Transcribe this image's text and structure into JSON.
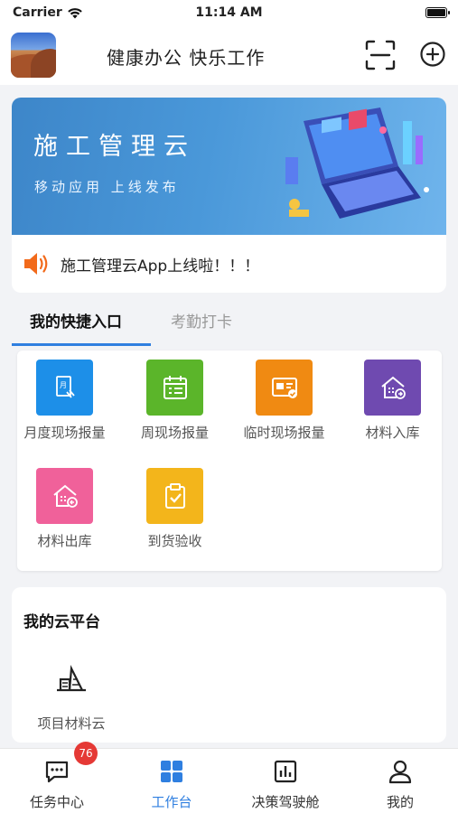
{
  "status_bar": {
    "carrier": "Carrier",
    "time": "11:14 AM"
  },
  "header": {
    "title": "健康办公 快乐工作"
  },
  "banner": {
    "title": "施工管理云",
    "subtitle": "移动应用  上线发布",
    "notice": "施工管理云App上线啦！！！"
  },
  "tabs": [
    {
      "label": "我的快捷入口",
      "active": true
    },
    {
      "label": "考勤打卡",
      "active": false
    }
  ],
  "quick_entries": [
    {
      "label": "月度现场报量",
      "color": "#1d8fe8",
      "icon": "monthly-report-icon"
    },
    {
      "label": "周现场报量",
      "color": "#5bb52a",
      "icon": "calendar-icon"
    },
    {
      "label": "临时现场报量",
      "color": "#f08a12",
      "icon": "id-card-icon"
    },
    {
      "label": "材料入库",
      "color": "#6f4ab0",
      "icon": "warehouse-in-icon"
    },
    {
      "label": "材料出库",
      "color": "#f0619a",
      "icon": "warehouse-out-icon"
    },
    {
      "label": "到货验收",
      "color": "#f3b51b",
      "icon": "clipboard-check-icon"
    }
  ],
  "cloud": {
    "title": "我的云平台",
    "items": [
      {
        "label": "项目材料云",
        "icon": "material-cloud-icon"
      }
    ]
  },
  "tabbar": [
    {
      "label": "任务中心",
      "icon": "chat-icon",
      "badge": "76",
      "active": false
    },
    {
      "label": "工作台",
      "icon": "grid-icon",
      "active": true
    },
    {
      "label": "决策驾驶舱",
      "icon": "bar-chart-icon",
      "active": false
    },
    {
      "label": "我的",
      "icon": "user-icon",
      "active": false
    }
  ],
  "colors": {
    "accent": "#2f7fe0",
    "badge": "#e53935"
  }
}
